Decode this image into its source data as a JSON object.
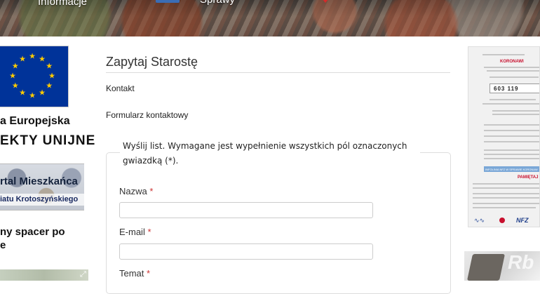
{
  "header": {
    "nav": {
      "informacje": "Informacje",
      "sprawy": "Sprawy"
    }
  },
  "left_column": {
    "eu_title": "a Europejska",
    "eu_subtitle": "EKTY  UNIJNE",
    "portal_line1": "rtal Mieszkańca",
    "portal_line2": "iatu Krotoszyńskiego",
    "walk_line1": "ny spacer po",
    "walk_line2": "e"
  },
  "main": {
    "title": "Zapytaj Starostę",
    "breadcrumb_contact": "Kontakt",
    "breadcrumb_form": "Formularz kontaktowy",
    "legend": "Wyślij list. Wymagane jest wypełnienie wszystkich pól oznaczonych gwiazdką (*).",
    "fields": {
      "name": {
        "label": "Nazwa",
        "value": ""
      },
      "email": {
        "label": "E-mail",
        "value": ""
      },
      "subject": {
        "label": "Temat"
      }
    },
    "required_mark": "*"
  },
  "right_column": {
    "poster": {
      "title": "KORONAWI",
      "phone_number": "603 119",
      "blue_bar_text": "INFOLINIA NFZ W SPRAWIE KORONAW",
      "pamietaj": "PAMIĘTAJ",
      "logo": "NFZ"
    },
    "banner_text": "Rb"
  },
  "colors": {
    "required": "#cc3333",
    "eu_blue": "#003399",
    "eu_gold": "#ffcc00",
    "poster_red": "#c8102e"
  }
}
